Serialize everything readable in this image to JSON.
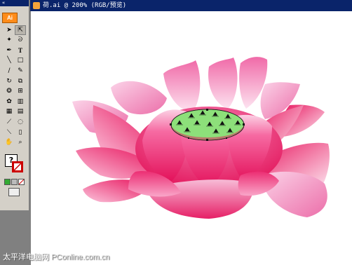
{
  "toolbox": {
    "header_label": "«",
    "logo_label": "Ai",
    "tools": [
      "selection-tool",
      "direct-selection-tool",
      "magic-wand-tool",
      "lasso-tool",
      "pen-tool",
      "type-tool",
      "line-tool",
      "rectangle-tool",
      "paintbrush-tool",
      "pencil-tool",
      "rotate-tool",
      "scale-tool",
      "warp-tool",
      "free-transform-tool",
      "symbol-sprayer-tool",
      "column-graph-tool",
      "mesh-tool",
      "gradient-tool",
      "eyedropper-tool",
      "blend-tool",
      "slice-tool",
      "eraser-tool",
      "hand-tool",
      "zoom-tool"
    ],
    "help_label": "?",
    "colors": {
      "fill": "#ffffff",
      "stroke": "#cc0000",
      "green": "#33aa33",
      "gray": "#999999"
    }
  },
  "document": {
    "title": "荷.ai @ 200% (RGB/预览)"
  },
  "artwork": {
    "name": "lotus",
    "palette": {
      "petal_dark": "#e8165f",
      "petal_mid": "#f561a0",
      "petal_light": "#fbe0ef",
      "center_green": "#8de07a"
    }
  },
  "watermark": {
    "cn": "太平洋电脑网",
    "en": "PConline.com.cn"
  }
}
